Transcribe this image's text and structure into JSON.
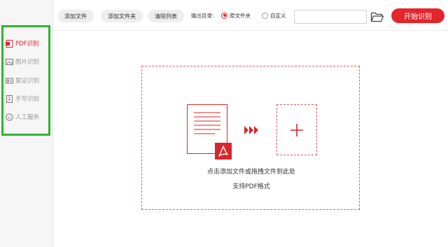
{
  "toolbar": {
    "add_file": "添加文件",
    "add_folder": "添加文件夹",
    "clear_list": "清除列表",
    "output_dir_label": "输出目录:",
    "radio_original": "原文件夹",
    "radio_custom": "自定义",
    "path_value": "",
    "start_button": "开始识别"
  },
  "sidebar": {
    "items": [
      {
        "label": "PDF识别",
        "icon": "pdf-icon",
        "active": true
      },
      {
        "label": "图片识别",
        "icon": "image-icon",
        "active": false
      },
      {
        "label": "票证识别",
        "icon": "ticket-icon",
        "active": false
      },
      {
        "label": "手写识别",
        "icon": "handwriting-icon",
        "active": false
      },
      {
        "label": "人工服务",
        "icon": "smiley-icon",
        "active": false
      }
    ]
  },
  "dropzone": {
    "line1": "点击添加文件或拖拽文件到此处",
    "line2": "支持PDF格式"
  },
  "colors": {
    "accent": "#e3262b",
    "highlight_box": "#2fb52f",
    "inactive_text": "#9a9a9a"
  }
}
